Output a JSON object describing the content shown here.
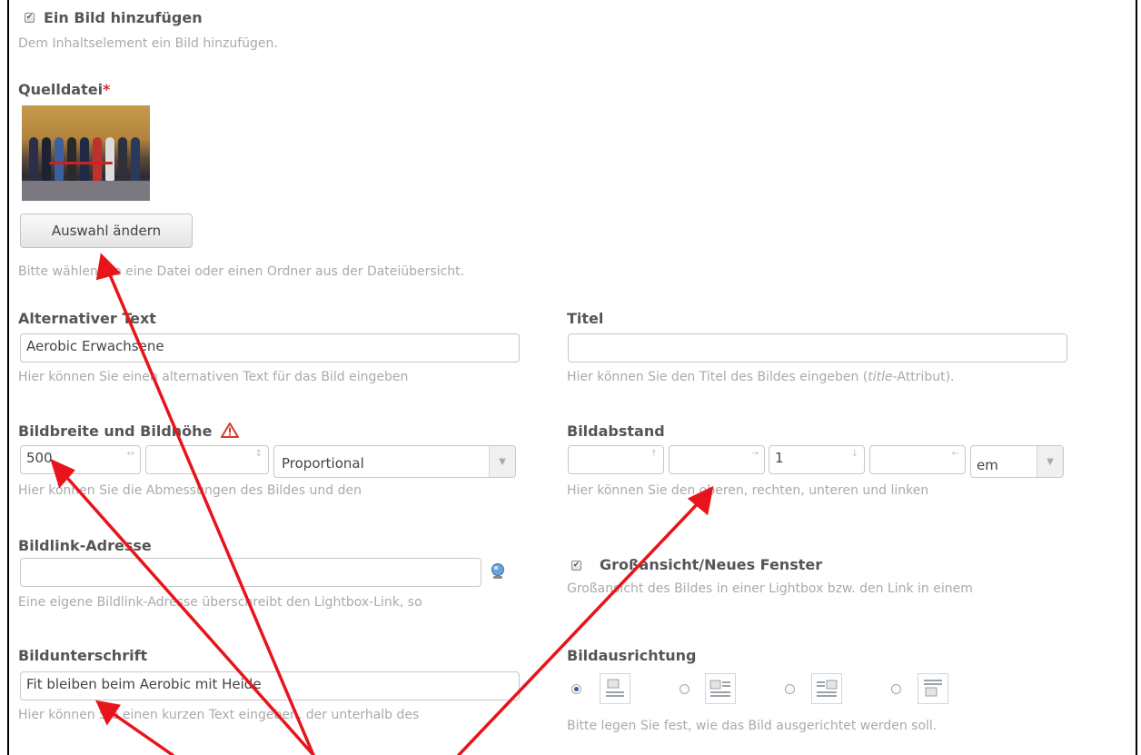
{
  "image_toggle": {
    "label": "Ein Bild hinzufügen",
    "help": "Dem Inhaltselement ein Bild hinzufügen.",
    "checked": true
  },
  "source": {
    "label": "Quelldatei",
    "required_mark": "*",
    "button": "Auswahl ändern",
    "help": "Bitte wählen Sie eine Datei oder einen Ordner aus der Dateiübersicht."
  },
  "alt": {
    "label": "Alternativer Text",
    "value": "Aerobic Erwachsene",
    "help": "Hier können Sie einen alternativen Text für das Bild eingeben"
  },
  "title": {
    "label": "Titel",
    "value": "",
    "help_pre": "Hier können Sie den Titel des Bildes eingeben (",
    "help_em": "title",
    "help_post": "-Attribut)."
  },
  "size": {
    "label": "Bildbreite und Bildhöhe",
    "warn_icon": "warning-icon",
    "width": "500",
    "height": "",
    "mode": "Proportional",
    "help": "Hier können Sie die Abmessungen des Bildes und den"
  },
  "margin": {
    "label": "Bildabstand",
    "top": "",
    "right": "",
    "bottom": "1",
    "left": "",
    "unit": "em",
    "help": "Hier können Sie den oberen, rechten, unteren und linken"
  },
  "link": {
    "label": "Bildlink-Adresse",
    "value": "",
    "picker_icon": "globe-icon",
    "help": "Eine eigene Bildlink-Adresse überschreibt den Lightbox-Link, so"
  },
  "fullsize": {
    "label": "Großansicht/Neues Fenster",
    "checked": true,
    "help": "Großansicht des Bildes in einer Lightbox bzw. den Link in einem"
  },
  "caption": {
    "label": "Bildunterschrift",
    "value": "Fit bleiben beim Aerobic mit Heide",
    "help": "Hier können Sie einen kurzen Text eingeben, der unterhalb des"
  },
  "floating": {
    "label": "Bildausrichtung",
    "options": [
      "above",
      "left",
      "right",
      "below"
    ],
    "selected": "above",
    "help": "Bitte legen Sie fest, wie das Bild ausgerichtet werden soll."
  },
  "annotation_color": "#e8141b"
}
